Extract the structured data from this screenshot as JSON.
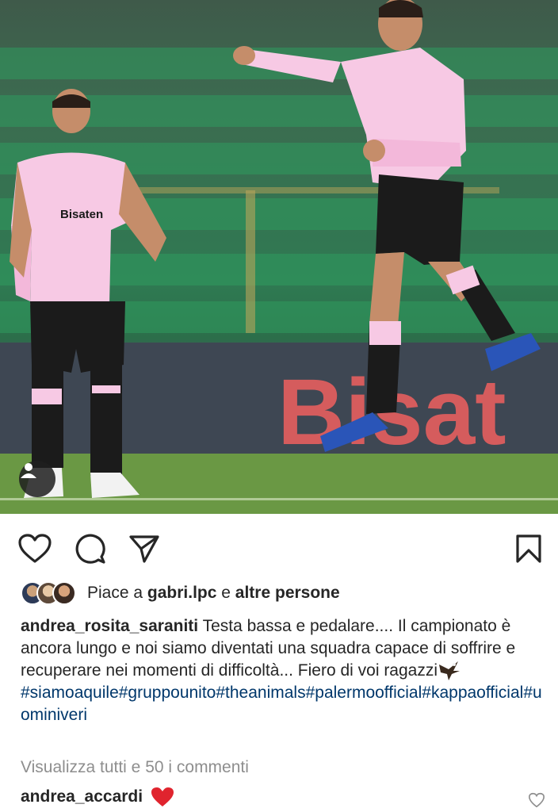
{
  "post": {
    "likes": {
      "prefix": "Piace a",
      "user": "gabri.lpc",
      "conjunction": "e",
      "others": "altre persone"
    },
    "caption": {
      "username": "andrea_rosita_saraniti",
      "text": "Testa bassa e pedalare.... Il campionato è ancora lungo e noi siamo diventati una squadra capace di soffrire e recuperare nei momenti di difficoltà... Fiero di voi ragazzi",
      "emoji": "eagle",
      "hashtags": "#siamoaquile#gruppounito#theanimals#palermoofficial#kappaofficial#uominiveri"
    },
    "comments_link": "Visualizza tutti e 50 i commenti",
    "top_comment": {
      "username": "andrea_accardi",
      "emoji": "❤️"
    },
    "photo_sponsor_banner": "Bisat",
    "icons": {
      "like": "heart-outline-icon",
      "comment": "speech-bubble-icon",
      "share": "paper-plane-icon",
      "save": "bookmark-icon",
      "user_tag": "person-icon",
      "comment_like": "heart-outline-icon"
    }
  }
}
